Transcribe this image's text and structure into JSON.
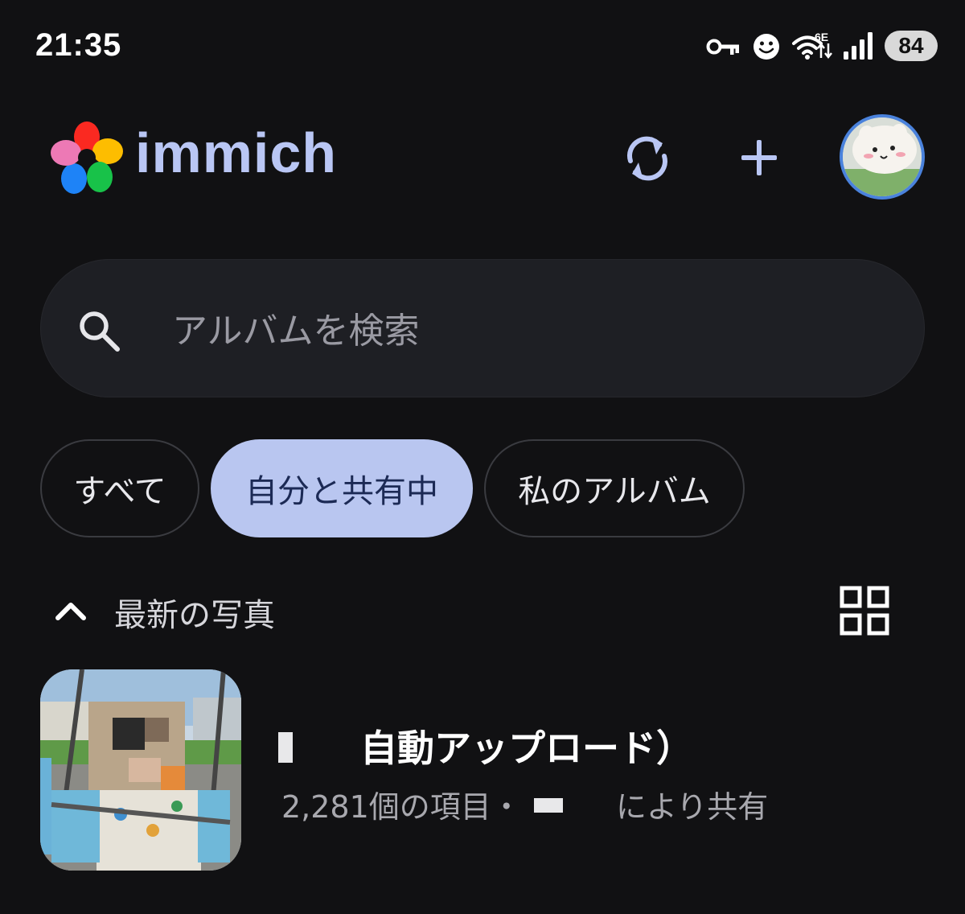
{
  "status_bar": {
    "time": "21:35",
    "wifi_badge": "6E",
    "battery": "84",
    "icons": [
      "vpn-key-icon",
      "smiley-icon",
      "wifi-icon",
      "signal-icon"
    ]
  },
  "header": {
    "app_name": "immich",
    "actions": [
      "sync-icon",
      "add-icon"
    ]
  },
  "search": {
    "placeholder": "アルバムを検索"
  },
  "filters": [
    {
      "label": "すべて",
      "active": false
    },
    {
      "label": "自分と共有中",
      "active": true
    },
    {
      "label": "私のアルバム",
      "active": false
    }
  ],
  "section": {
    "title": "最新の写真",
    "collapse_icon": "chevron-up-icon",
    "view_icon": "grid-view-icon"
  },
  "albums": [
    {
      "title": "自動アップロード）",
      "count_text": "2,281個の項目・",
      "shared_text": "により共有"
    }
  ],
  "colors": {
    "background": "#111113",
    "accent": "#b9c6f0",
    "logo_text": "#b9c6f4",
    "search_bg": "#1e1f24"
  }
}
